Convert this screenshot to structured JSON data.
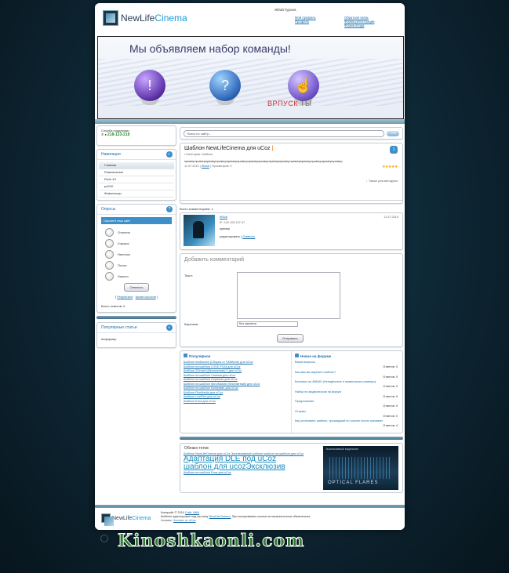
{
  "header": {
    "logo_prefix": "NewLife",
    "logo_suffix": "Cinema",
    "greeting": "Жбой Гурсил,",
    "links_col1": [
      "Мой профиль",
      "Профиль"
    ],
    "links_col2": [
      "Обратная связь",
      "Форма регистрации",
      "Форма входа"
    ]
  },
  "banner": {
    "title": "Мы объявляем набор команды!",
    "sub_prefix": "ВРПУСК",
    "sub_suffix": "ТЫ",
    "glyphs": [
      "!",
      "?",
      "☝"
    ]
  },
  "sidebar": {
    "support": {
      "label": "Служба поддержки",
      "phone": "218-123-218"
    },
    "menu_title": "Навигация",
    "menu_items": [
      "Главная",
      "Развлечения",
      "Rock 4X",
      "рэ0Х0",
      "Живописцы"
    ],
    "poll": {
      "title": "Опросы",
      "question": "Оцените наш сайт",
      "options": [
        "Отлично",
        "Хорошо",
        "Неплохо",
        "Плохо",
        "Ужасно"
      ],
      "button": "Ответить",
      "results_link": "Результаты",
      "archive_link": "Архив опросов",
      "total": "Всего ответов: 0"
    },
    "popular_title": "Популярные статьи",
    "popular_text": "информер"
  },
  "search": {
    "placeholder": "Поиск по сайту...",
    "button": "⟶"
  },
  "entry": {
    "title": "Шаблон NewLifeCinema для uCoz",
    "amp": "|",
    "meta": "Категория: Шаблон",
    "text": "примерпримерпримерпримерпримерпримерпримерпримерпримерпримерпримерпримерпримерпримерпример",
    "date": "11.07.2010",
    "author": "Жбой",
    "views": "Просмотров: 0",
    "comments_count": "1",
    "stars": "★★★★★",
    "rec": "↓ Также рекомендуем"
  },
  "comments": {
    "total": "Всего комментариев: 1",
    "items": [
      {
        "author": "Жбой",
        "ip": "IP: 100.100.107.47",
        "text": "пример",
        "actions": "редактировать |",
        "reply": "Ответить",
        "date": "11.07.2010"
      }
    ]
  },
  "form": {
    "title": "Добавить комментарий",
    "text_label": "Текст:",
    "code_label": "Картинка:",
    "code_value": "Без картинки",
    "submit": "Отправить"
  },
  "popular": {
    "title": "Популярное",
    "items": [
      "Шаблон winMovies (Сборка от SMMovie) для uCoz",
      "Шаблон на шаблон LOVE-FILM для uCoz",
      "Шаблон ZOrwell ((бесплатная) 2 для uCoz",
      "Шаблон на шаблон Синема для uCoz",
      "Шаблон на шаблон Сериалы для uCoz",
      "Шаблон на шаблон КиноМания (бесплатный) для uCoz",
      "Шаблон на шаблон Вотерман для uCoz",
      "Шаблон FilmMedia для uCoz",
      "Шаблон LiveFilm для uCoz",
      "Шаблон Блэк для uCoz"
    ]
  },
  "forum": {
    "title": "Новое на форуме",
    "items": [
      {
        "title": "Ваши вопросы",
        "replies": "Ответов: 0"
      },
      {
        "title": "Как вам мы вариант шаблон?",
        "replies": "Ответов: 0"
      },
      {
        "title": "Баннеры на 468х60 (Ненадёжные и правильные размеры)",
        "replies": "Ответов: 0"
      },
      {
        "title": "Набор на модераторов на форум",
        "replies": "Ответов: 0"
      },
      {
        "title": "Предложения",
        "replies": "Ответов: 0"
      },
      {
        "title": "Отзывы",
        "replies": "Ответов: 0"
      },
      {
        "title": "Как установить шаблон, прошедший по ссылке после скачивания",
        "replies": "Ответов: 4"
      }
    ]
  },
  "tags": {
    "title": "Облако тегов",
    "small1": "Шаблон NewLifeCinema для uCoz Эксклюзивный шаблон шаблон на шаблон для uCoz",
    "big1": "Адаптация DLE под uCoz",
    "big2": "шаблон для ucoz",
    "big3": "Эксклюзив",
    "small2": "Шаблон на шаблон Блэк для uCoz"
  },
  "promo": {
    "top": "Эксклюзивный видеоклип",
    "name": "OPTICAL FLARES"
  },
  "footer": {
    "logo_prefix": "NewLife",
    "logo_suffix": "Cinema",
    "copyright_label": "Копирайт © 2010",
    "copyright_link": "Сайт NNN",
    "line2": "Шаблон адаптирован под систему",
    "line2_link": "NewLifeCinema.",
    "line2_rest": "При копировании ссылка на первоисточник обязательна",
    "line3_label": "Хостинг:",
    "line3_link": "Хостинг от uCoz"
  },
  "watermark": "Kinoshkaonli.com"
}
